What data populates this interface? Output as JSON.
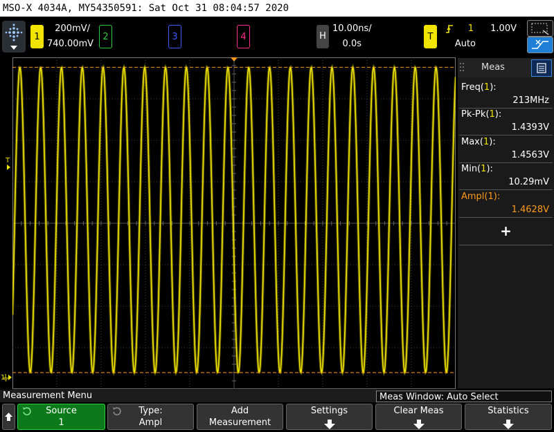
{
  "title": "MSO-X 4034A, MY54350591: Sat Oct 31 08:04:57 2020",
  "channels": {
    "ch1": {
      "label": "1",
      "scale": "200mV/",
      "offset": "740.00mV",
      "color": "#f0e400"
    },
    "ch2": {
      "label": "2",
      "color": "#2ecc40"
    },
    "ch3": {
      "label": "3",
      "color": "#3a5bff"
    },
    "ch4": {
      "label": "4",
      "color": "#ff2d8a"
    }
  },
  "horizontal": {
    "label": "H",
    "timebase": "10.00ns/",
    "delay": "0.0s"
  },
  "trigger": {
    "label": "T",
    "source": "1",
    "level": "1.00V",
    "mode": "Auto"
  },
  "meas_panel": {
    "tab": "Meas",
    "items": [
      {
        "name": "Freq",
        "ch": "1",
        "value": "213MHz",
        "highlight": false
      },
      {
        "name": "Pk-Pk",
        "ch": "1",
        "value": "1.4393V",
        "highlight": false
      },
      {
        "name": "Max",
        "ch": "1",
        "value": "1.4563V",
        "highlight": false
      },
      {
        "name": "Min",
        "ch": "1",
        "value": "10.29mV",
        "highlight": false
      },
      {
        "name": "Ampl",
        "ch": "1",
        "value": "1.4628V",
        "highlight": true
      }
    ],
    "add": "+"
  },
  "waveform": {
    "cycles": 21.3,
    "top_level_fraction": 0.03,
    "bottom_level_fraction": 0.95,
    "color": "#f0e400"
  },
  "menu": {
    "title": "Measurement Menu",
    "meas_window": "Meas Window: Auto Select",
    "softkeys": [
      {
        "line1": "Source",
        "line2": "1"
      },
      {
        "line1": "Type:",
        "line2": "Ampl"
      },
      {
        "line1": "Add",
        "line2": "Measurement"
      },
      {
        "line1": "Settings",
        "line2": ""
      },
      {
        "line1": "Clear Meas",
        "line2": ""
      },
      {
        "line1": "Statistics",
        "line2": ""
      }
    ]
  }
}
